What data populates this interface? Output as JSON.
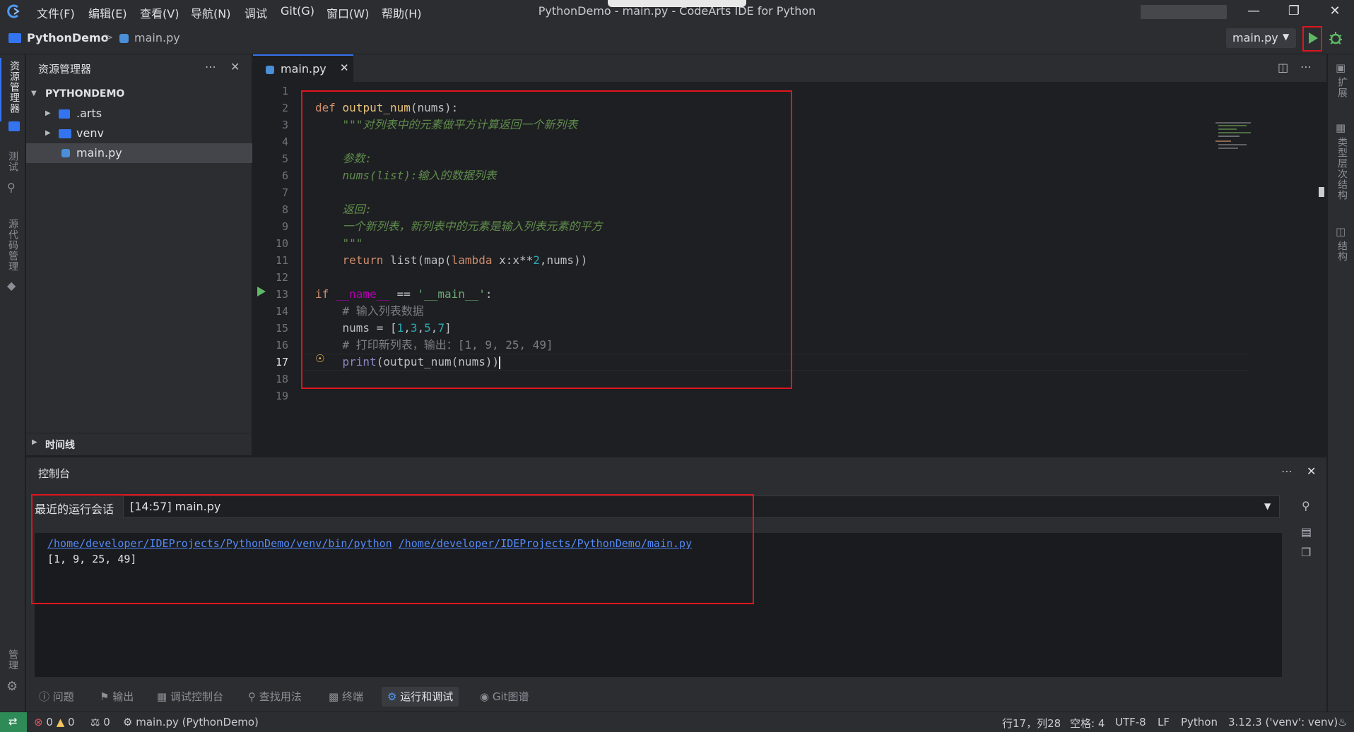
{
  "app": {
    "menu": [
      "文件(F)",
      "编辑(E)",
      "查看(V)",
      "导航(N)",
      "调试",
      "Git(G)",
      "窗口(W)",
      "帮助(H)"
    ],
    "window_title": "PythonDemo - main.py - CodeArts IDE for Python"
  },
  "breadcrumb": {
    "project": "PythonDemo",
    "sep": ">",
    "file": "main.py"
  },
  "run_config": {
    "selected": "main.py"
  },
  "activity": {
    "explorer": "资源管理器",
    "test": "测试",
    "scm": "源代码管理",
    "settings_label": "管理"
  },
  "rightrail": {
    "extensions": "扩展",
    "type_hierarchy": "类型层次结构",
    "structure": "结构"
  },
  "explorer": {
    "title": "资源管理器",
    "root": "PYTHONDEMO",
    "items": [
      {
        "label": ".arts",
        "type": "folder"
      },
      {
        "label": "venv",
        "type": "folder"
      },
      {
        "label": "main.py",
        "type": "file"
      }
    ],
    "timeline": "时间线"
  },
  "editor": {
    "tab": "main.py",
    "line_numbers": [
      "1",
      "2",
      "3",
      "4",
      "5",
      "6",
      "7",
      "8",
      "9",
      "10",
      "11",
      "12",
      "13",
      "14",
      "15",
      "16",
      "17",
      "18",
      "19"
    ],
    "code": {
      "l2_kw": "def",
      "l2_fn": "output_num",
      "l2_rest": "(nums):",
      "l3": "    \"\"\"对列表中的元素做平方计算返回一个新列表",
      "l5": "    参数:",
      "l6": "    nums(list):输入的数据列表",
      "l8": "    返回:",
      "l9": "    一个新列表，新列表中的元素是输入列表元素的平方",
      "l10": "    \"\"\"",
      "l11_kw": "    return",
      "l11_rest_a": " list(map(",
      "l11_kw2": "lambda",
      "l11_rest_b": " x:x**",
      "l11_num": "2",
      "l11_rest_c": ",nums))",
      "l13_kw": "if",
      "l13_magic": " __name__",
      "l13_op": " == ",
      "l13_str": "'__main__'",
      "l13_end": ":",
      "l14": "    # 输入列表数据",
      "l15_a": "    nums = [",
      "l15_n1": "1",
      "l15_c1": ",",
      "l15_n2": "3",
      "l15_c2": ",",
      "l15_n3": "5",
      "l15_c3": ",",
      "l15_n4": "7",
      "l15_b": "]",
      "l16": "    # 打印新列表，输出：[1, 9, 25, 49]",
      "l17_bi": "    print",
      "l17_rest": "(output_num(nums))"
    }
  },
  "console": {
    "title": "控制台",
    "session_label": "最近的运行会话",
    "session_value": "[14:57] main.py",
    "output_link1": "/home/developer/IDEProjects/PythonDemo/venv/bin/python",
    "output_link2": "/home/developer/IDEProjects/PythonDemo/main.py",
    "output_result": "[1, 9, 25, 49]"
  },
  "bottom_tabs": [
    "问题",
    "输出",
    "调试控制台",
    "查找用法",
    "终端",
    "运行和调试",
    "Git图谱"
  ],
  "status": {
    "errors": "0",
    "warnings": "0",
    "ports": "0",
    "run_target": "main.py (PythonDemo)",
    "cursor": "行17，列28",
    "spaces": "空格: 4",
    "encoding": "UTF-8",
    "eol": "LF",
    "language": "Python",
    "interpreter": "3.12.3 ('venv': venv)"
  },
  "colors": {
    "accent": "#3574f0",
    "run_green": "#5fb865",
    "highlight_red": "#e0141e"
  }
}
